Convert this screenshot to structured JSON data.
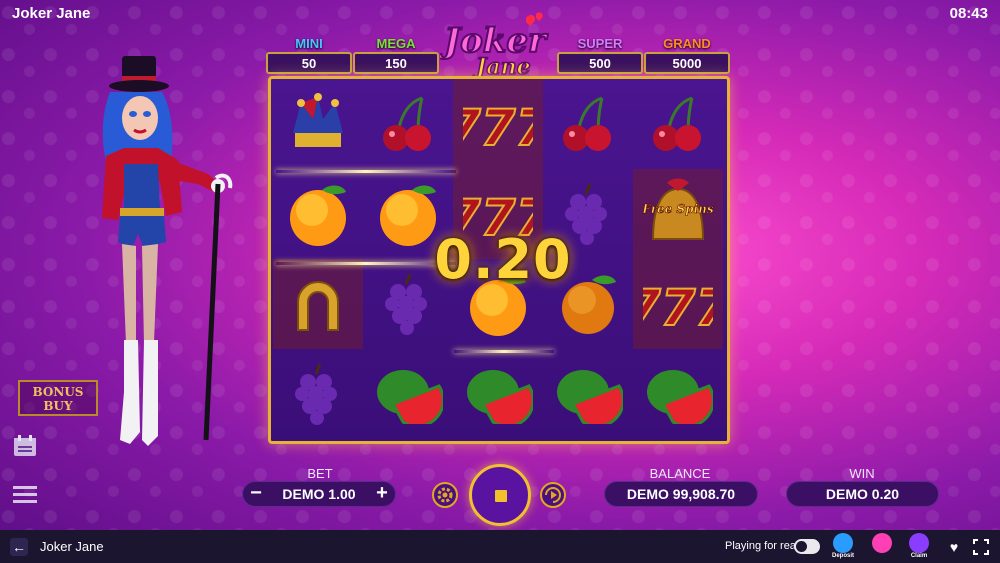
{
  "header": {
    "title": "Joker Jane",
    "clock": "08:43"
  },
  "logo": {
    "line1": "Joker",
    "line2": "Jane"
  },
  "jackpots": [
    {
      "name": "MINI",
      "value": "50",
      "color": "#49c3ff"
    },
    {
      "name": "MEGA",
      "value": "150",
      "color": "#7ae03a"
    },
    {
      "name": "SUPER",
      "value": "500",
      "color": "#d47bff"
    },
    {
      "name": "GRAND",
      "value": "5000",
      "color": "#ff8a2a"
    }
  ],
  "bonus_buy": {
    "line1": "BONUS",
    "line2": "BUY"
  },
  "reels": [
    [
      "jester-hat",
      "orange",
      "horseshoe",
      "grapes"
    ],
    [
      "cherry",
      "orange",
      "grapes",
      "watermelon"
    ],
    [
      "seven",
      "seven",
      "orange",
      "watermelon"
    ],
    [
      "cherry",
      "grapes",
      "orange",
      "watermelon"
    ],
    [
      "cherry",
      "free-spins-bell",
      "seven",
      "watermelon"
    ]
  ],
  "free_spins_text": "Free Spins",
  "win_amount": "0.20",
  "controls": {
    "bet_label": "BET",
    "bet_value": "DEMO 1.00",
    "minus": "−",
    "plus": "+",
    "balance_label": "BALANCE",
    "balance_value": "DEMO 99,908.70",
    "win_label": "WIN",
    "win_value": "DEMO 0.20"
  },
  "statusbar": {
    "title": "Joker Jane",
    "playing_label": "Playing for real",
    "playing_toggle": false,
    "promos": [
      {
        "name": "BONUZ",
        "caption": "Deposit",
        "color": "#2a9bff"
      },
      {
        "name": "PRIZE",
        "caption": "",
        "color": "#ff3fb4"
      },
      {
        "name": "JACKPOTZ",
        "caption": "Claim",
        "color": "#8a3cff"
      }
    ]
  }
}
